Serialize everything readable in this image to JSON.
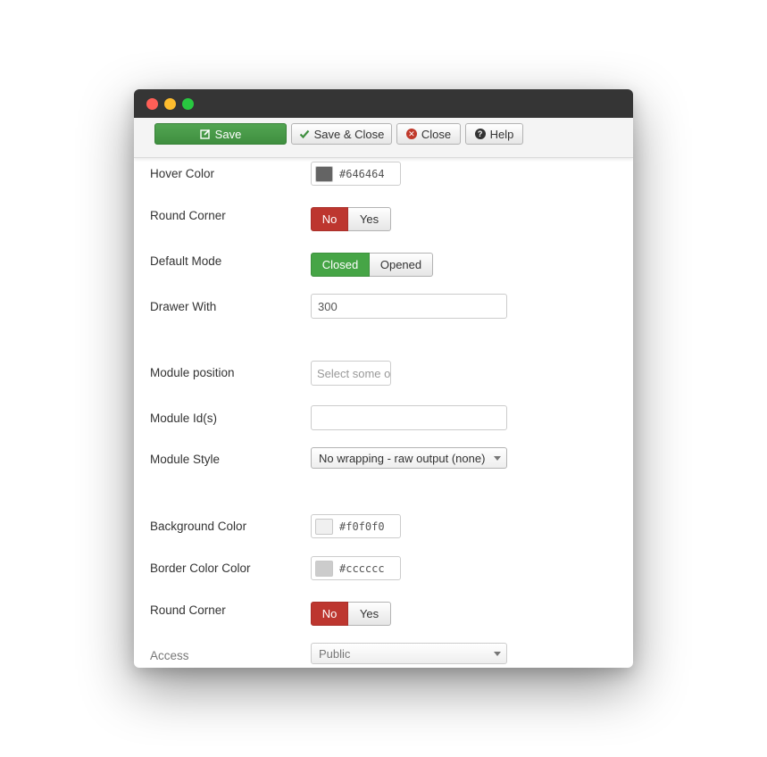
{
  "window": {
    "traffic_lights": {
      "close": "#ff5f57",
      "minimize": "#febc2e",
      "zoom": "#28c840"
    }
  },
  "toolbar": {
    "save_label": "Save",
    "save_close_label": "Save & Close",
    "close_label": "Close",
    "help_label": "Help"
  },
  "form": {
    "hover_color": {
      "label": "Hover Color",
      "value": "#646464",
      "swatch": "#646464"
    },
    "round_corner_1": {
      "label": "Round Corner",
      "no": "No",
      "yes": "Yes",
      "selected": "No"
    },
    "default_mode": {
      "label": "Default Mode",
      "closed": "Closed",
      "opened": "Opened",
      "selected": "Closed"
    },
    "drawer_with": {
      "label": "Drawer With",
      "value": "300"
    },
    "module_position": {
      "label": "Module position",
      "placeholder": "Select some o"
    },
    "module_ids": {
      "label": "Module Id(s)",
      "value": ""
    },
    "module_style": {
      "label": "Module Style",
      "value": "No wrapping - raw output (none)"
    },
    "background_color": {
      "label": "Background Color",
      "value": "#f0f0f0",
      "swatch": "#f0f0f0"
    },
    "border_color": {
      "label": "Border Color Color",
      "value": "#cccccc",
      "swatch": "#cccccc"
    },
    "round_corner_2": {
      "label": "Round Corner",
      "no": "No",
      "yes": "Yes",
      "selected": "No"
    },
    "access": {
      "label": "Access",
      "value": "Public"
    }
  },
  "colors": {
    "save_button": "#46a546",
    "toggle_no_active": "#bd362f",
    "toggle_closed_active": "#46a546",
    "titlebar": "#353535"
  }
}
